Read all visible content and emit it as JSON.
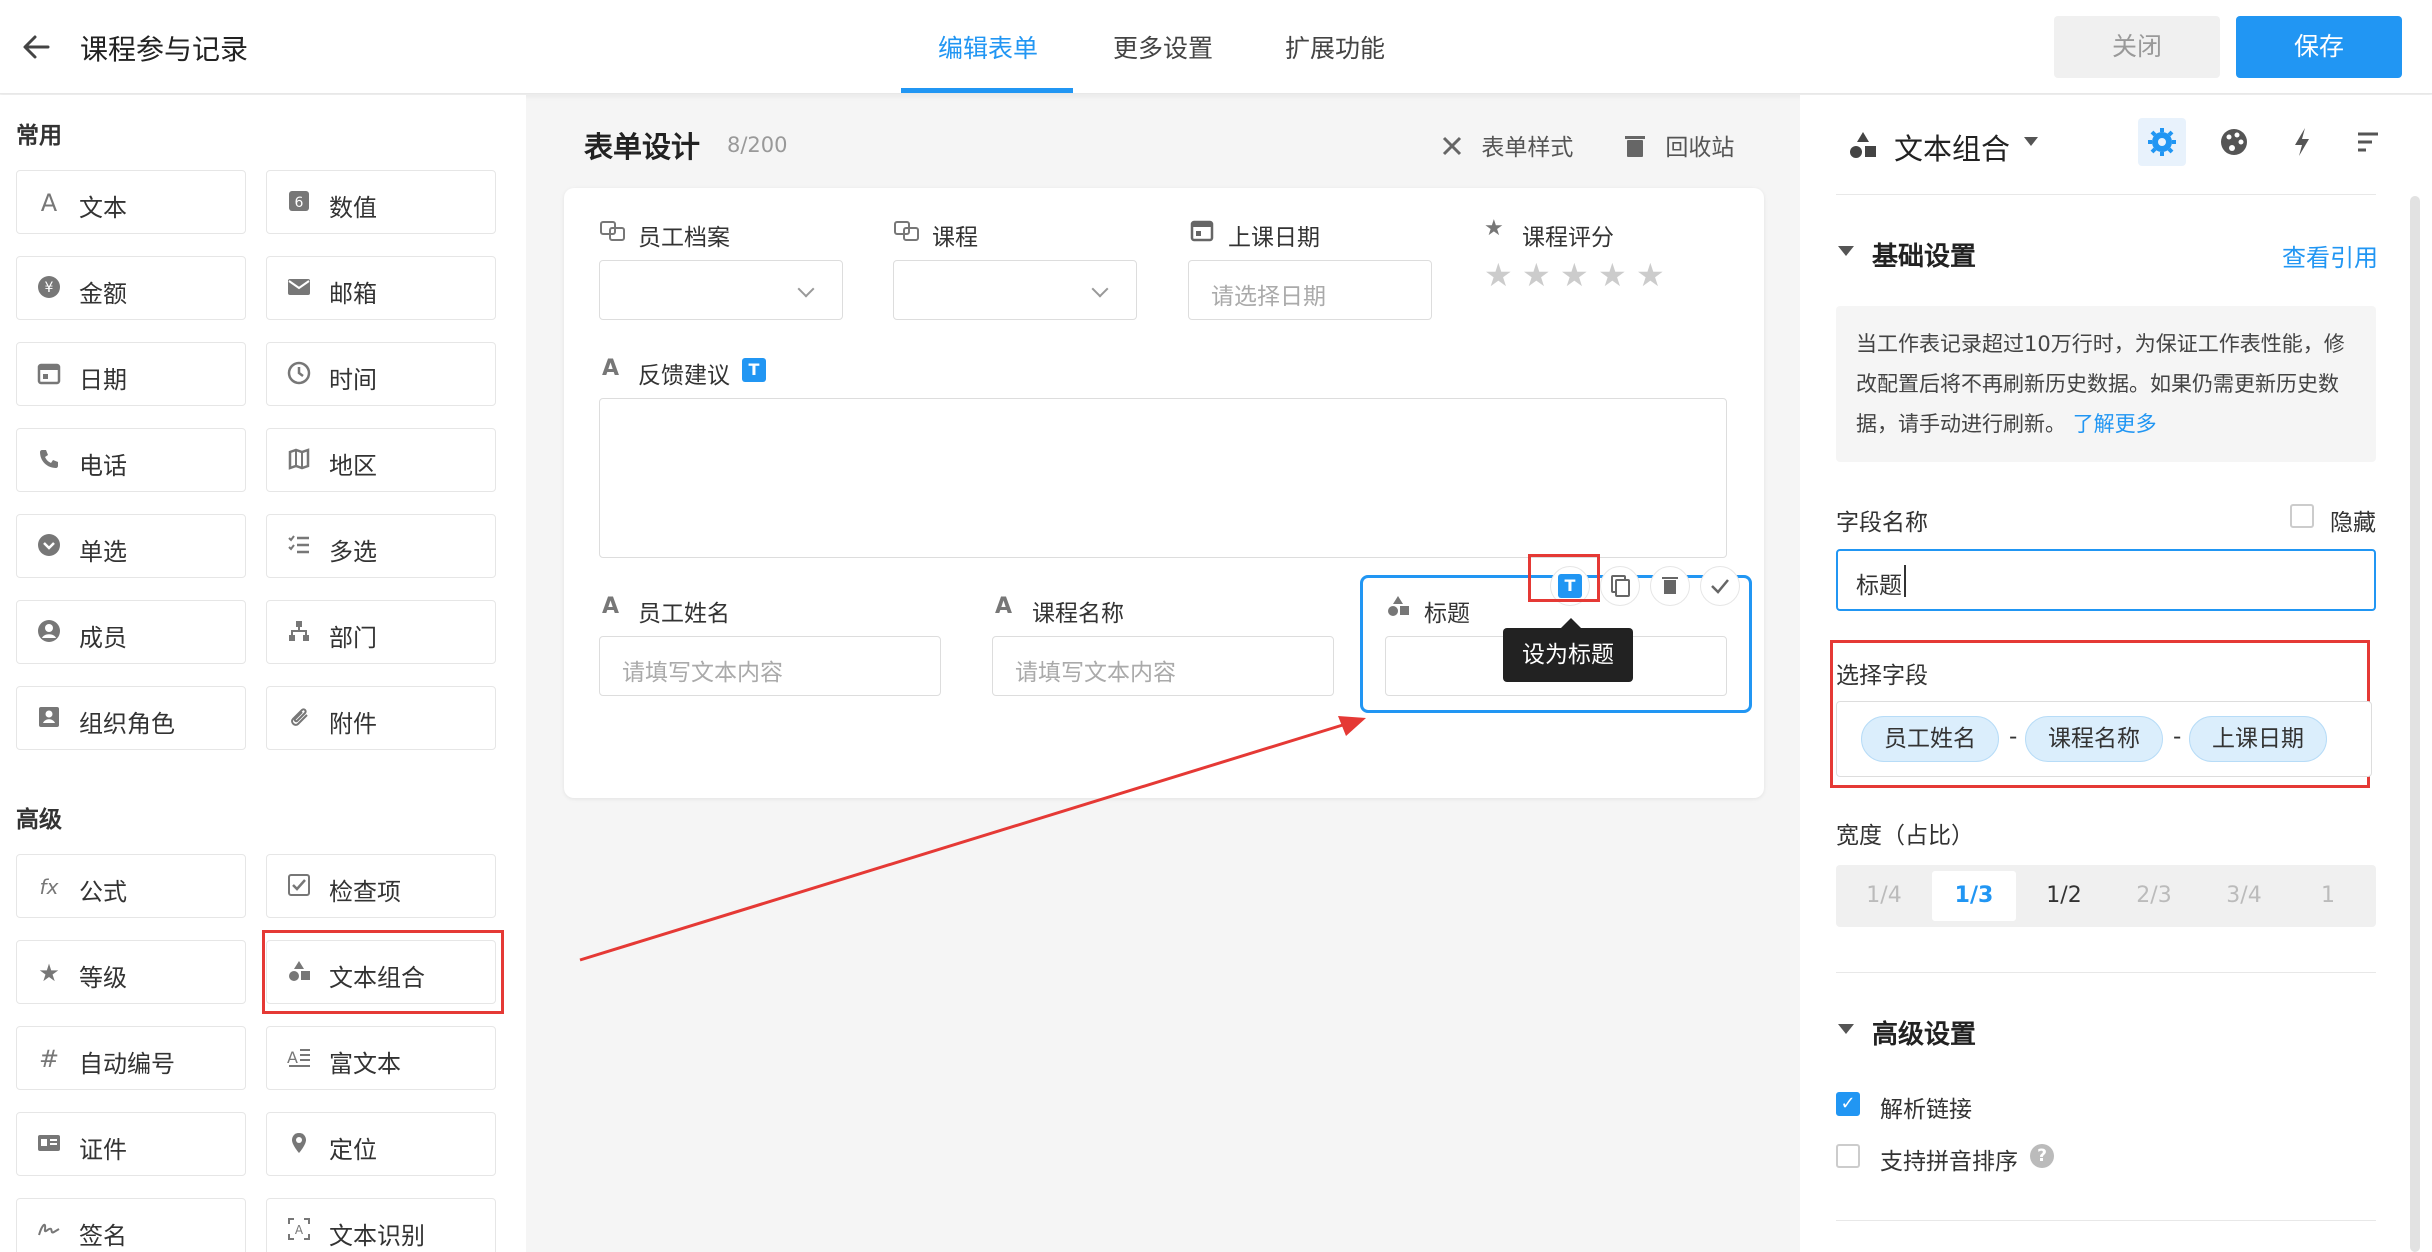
{
  "header": {
    "title": "课程参与记录",
    "tabs": [
      "编辑表单",
      "更多设置",
      "扩展功能"
    ],
    "close_label": "关闭",
    "save_label": "保存"
  },
  "sidebar": {
    "common_label": "常用",
    "advanced_label": "高级",
    "common": [
      {
        "label": "文本",
        "icon": "text-icon"
      },
      {
        "label": "数值",
        "icon": "number-icon"
      },
      {
        "label": "金额",
        "icon": "currency-icon"
      },
      {
        "label": "邮箱",
        "icon": "mail-icon"
      },
      {
        "label": "日期",
        "icon": "calendar-icon"
      },
      {
        "label": "时间",
        "icon": "clock-icon"
      },
      {
        "label": "电话",
        "icon": "phone-icon"
      },
      {
        "label": "地区",
        "icon": "map-icon"
      },
      {
        "label": "单选",
        "icon": "radio-icon"
      },
      {
        "label": "多选",
        "icon": "checklist-icon"
      },
      {
        "label": "成员",
        "icon": "user-icon"
      },
      {
        "label": "部门",
        "icon": "org-icon"
      },
      {
        "label": "组织角色",
        "icon": "role-icon"
      },
      {
        "label": "附件",
        "icon": "paperclip-icon"
      }
    ],
    "advanced": [
      {
        "label": "公式",
        "icon": "formula-icon"
      },
      {
        "label": "检查项",
        "icon": "checkbox-icon"
      },
      {
        "label": "等级",
        "icon": "star-icon"
      },
      {
        "label": "文本组合",
        "icon": "shapes-icon"
      },
      {
        "label": "自动编号",
        "icon": "hash-icon"
      },
      {
        "label": "富文本",
        "icon": "richtext-icon"
      },
      {
        "label": "证件",
        "icon": "id-card-icon"
      },
      {
        "label": "定位",
        "icon": "location-icon"
      },
      {
        "label": "签名",
        "icon": "signature-icon"
      },
      {
        "label": "文本识别",
        "icon": "ocr-icon"
      }
    ]
  },
  "form": {
    "title": "表单设计",
    "count": "8/200",
    "style_label": "表单样式",
    "trash_label": "回收站",
    "fields": {
      "employee_file": "员工档案",
      "course": "课程",
      "class_date": "上课日期",
      "class_date_placeholder": "请选择日期",
      "rating": "课程评分",
      "feedback": "反馈建议",
      "employee_name": "员工姓名",
      "course_name": "课程名称",
      "text_placeholder": "请填写文本内容",
      "title_field": "标题"
    },
    "tooltip": "设为标题",
    "title_badge": "T"
  },
  "panel": {
    "header_title": "文本组合",
    "basic_settings": "基础设置",
    "view_refs": "查看引用",
    "notice": "当工作表记录超过10万行时，为保证工作表性能，修改配置后将不再刷新历史数据。如果仍需更新历史数据，请手动进行刷新。",
    "notice_link": "了解更多",
    "field_name_label": "字段名称",
    "hidden_label": "隐藏",
    "field_name_value": "标题",
    "select_fields_label": "选择字段",
    "chips": [
      "员工姓名",
      "课程名称",
      "上课日期"
    ],
    "chip_sep": "-",
    "width_label": "宽度（占比）",
    "width_options": [
      "1/4",
      "1/3",
      "1/2",
      "2/3",
      "3/4",
      "1"
    ],
    "width_selected": "1/3",
    "advanced_settings": "高级设置",
    "parse_links": "解析链接",
    "pinyin_sort": "支持拼音排序",
    "help_mark": "?"
  },
  "colors": {
    "accent": "#2196f3",
    "highlight": "#e53935"
  }
}
